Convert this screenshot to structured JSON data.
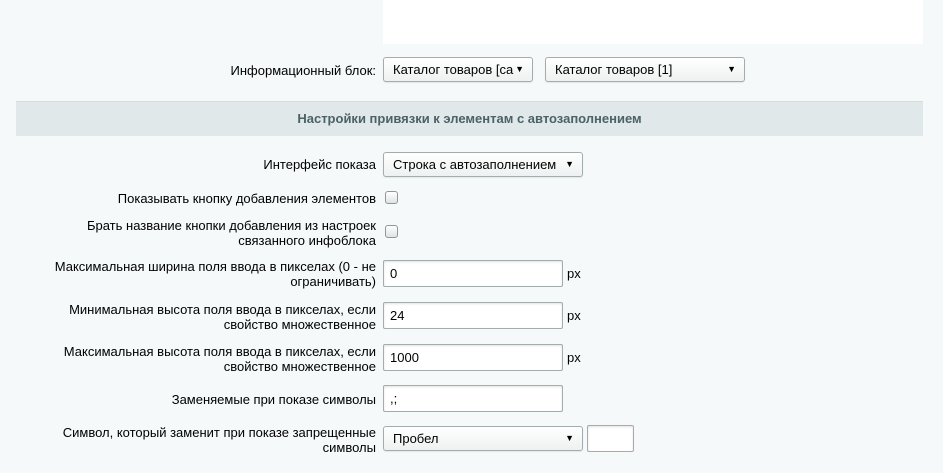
{
  "iblock": {
    "label": "Информационный блок:",
    "type_select": "Каталог товаров [ca",
    "block_select": "Каталог товаров [1]"
  },
  "section_title": "Настройки привязки к элементам с автозаполнением",
  "fields": {
    "interface": {
      "label": "Интерфейс показа",
      "value": "Строка с автозаполнением"
    },
    "show_add_button": {
      "label": "Показывать кнопку добавления элементов",
      "checked": false
    },
    "take_button_name": {
      "label_line1": "Брать название кнопки добавления из настроек",
      "label_line2": "связанного инфоблока",
      "checked": false
    },
    "max_width": {
      "label_line1": "Максимальная ширина поля ввода в пикселах (0 - не",
      "label_line2": "ограничивать)",
      "value": "0",
      "unit": "px"
    },
    "min_height": {
      "label_line1": "Минимальная высота поля ввода в пикселах, если",
      "label_line2": "свойство множественное",
      "value": "24",
      "unit": "px"
    },
    "max_height": {
      "label_line1": "Максимальная высота поля ввода в пикселах, если",
      "label_line2": "свойство множественное",
      "value": "1000",
      "unit": "px"
    },
    "replace_symbols": {
      "label": "Заменяемые при показе символы",
      "value": ",;"
    },
    "replacement_symbol": {
      "label_line1": "Символ, который заменит при показе запрещенные",
      "label_line2": "символы",
      "value": "Пробел",
      "extra_value": ""
    }
  },
  "icons": {
    "dropdown": "triangle-down"
  }
}
